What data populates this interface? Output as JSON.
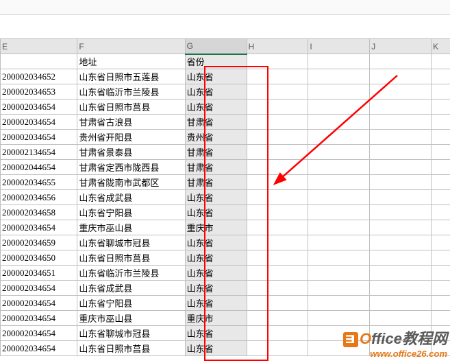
{
  "columns": [
    "E",
    "F",
    "G",
    "H",
    "I",
    "J",
    "K"
  ],
  "selected_col_index": 2,
  "header_row": {
    "E": "",
    "F": "地址",
    "G": "省份",
    "H": "",
    "I": "",
    "J": "",
    "K": ""
  },
  "rows": [
    {
      "E": "200002034652",
      "F": "山东省日照市五莲县",
      "G": "山东省"
    },
    {
      "E": "200002034653",
      "F": "山东省临沂市兰陵县",
      "G": "山东省"
    },
    {
      "E": "200002034654",
      "F": "山东省日照市莒县",
      "G": "山东省"
    },
    {
      "E": "200002034654",
      "F": "甘肃省古浪县",
      "G": "甘肃省"
    },
    {
      "E": "200002034654",
      "F": "贵州省开阳县",
      "G": "贵州省"
    },
    {
      "E": "200002134654",
      "F": "甘肃省景泰县",
      "G": "甘肃省"
    },
    {
      "E": "200002044654",
      "F": "甘肃省定西市陇西县",
      "G": "甘肃省"
    },
    {
      "E": "200002034655",
      "F": "甘肃省陇南市武都区",
      "G": "甘肃省"
    },
    {
      "E": "200002034656",
      "F": "山东省成武县",
      "G": "山东省"
    },
    {
      "E": "200002034658",
      "F": "山东省宁阳县",
      "G": "山东省"
    },
    {
      "E": "200002034654",
      "F": "重庆市巫山县",
      "G": "重庆市"
    },
    {
      "E": "200002034659",
      "F": "山东省聊城市冠县",
      "G": "山东省"
    },
    {
      "E": "200002034650",
      "F": "山东省日照市莒县",
      "G": "山东省"
    },
    {
      "E": "200002034651",
      "F": "山东省临沂市兰陵县",
      "G": "山东省"
    },
    {
      "E": "200002034654",
      "F": "山东省成武县",
      "G": "山东省"
    },
    {
      "E": "200002034654",
      "F": "山东省宁阳县",
      "G": "山东省"
    },
    {
      "E": "200002034654",
      "F": "重庆市巫山县",
      "G": "重庆市"
    },
    {
      "E": "200002034654",
      "F": "山东省聊城市冠县",
      "G": "山东省"
    },
    {
      "E": "200002034654",
      "F": "山东省日照市莒县",
      "G": "山东省"
    }
  ],
  "watermark": {
    "brand_prefix": "O",
    "brand_rest": "ffice教程网",
    "url": "www.office26.com"
  }
}
